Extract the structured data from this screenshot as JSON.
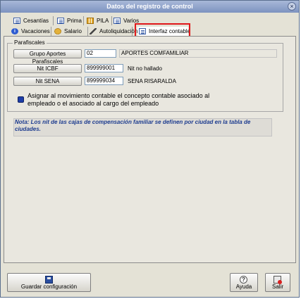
{
  "window": {
    "title": "Datos del registro de control",
    "close_glyph": "×"
  },
  "tabs_row1": [
    {
      "label": "Cesantías",
      "icon": "document-icon"
    },
    {
      "label": "Prima",
      "icon": "document-icon"
    },
    {
      "label": "PILA",
      "icon": "grid-icon"
    },
    {
      "label": "Varios",
      "icon": "document-icon"
    }
  ],
  "tabs_row2": [
    {
      "label": "Vacaciones",
      "icon": "info-circle-icon",
      "glyph": "i"
    },
    {
      "label": "Salario",
      "icon": "gear-icon"
    },
    {
      "label": "Autoliquidación",
      "icon": "pen-icon"
    },
    {
      "label": "Interfaz contable",
      "icon": "document-icon",
      "active": true
    }
  ],
  "group": {
    "label": "Parafiscales",
    "rows": [
      {
        "button": "Grupo Aportes Parafiscales",
        "code": "02",
        "description": "APORTES COMFAMILIAR"
      },
      {
        "button": "Nit ICBF",
        "code": "899999001",
        "description": "Nit no hallado"
      },
      {
        "button": "Nit SENA",
        "code": "899999034",
        "description": "SENA RISARALDA"
      }
    ]
  },
  "option": {
    "text": "Asignar al movimiento contable el concepto contable asociado al empleado o el asociado al cargo del empleado",
    "checked": true
  },
  "note": "Nota: Los nit de las cajas de compensación familiar se definen por ciudad en la tabla de ciudades.",
  "footer": {
    "save": "Guardar configuración",
    "help": "Ayuda",
    "help_glyph": "?",
    "exit": "Salir"
  },
  "colors": {
    "highlight": "#e0181b",
    "note_text": "#1c3b8f",
    "checkbox": "#1e3ea8"
  }
}
